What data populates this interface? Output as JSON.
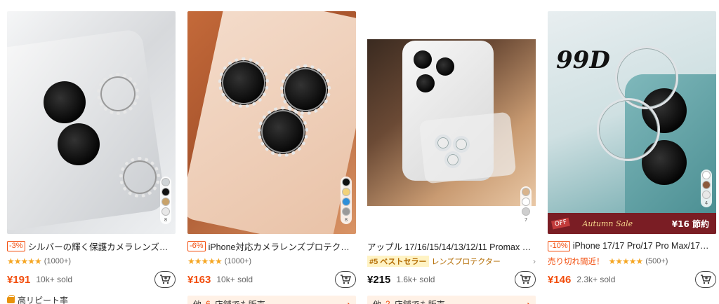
{
  "products": [
    {
      "discount": "-3%",
      "title": "シルバーの輝く保護カメラレンズ…",
      "rating_count": "(1000+)",
      "price": "¥191",
      "sold": "10k+ sold",
      "extra": "高リピート率",
      "swatch_count": "8",
      "swatches": [
        "#cfd3d6",
        "#111111",
        "#c8a26a",
        "#e8e8e8"
      ]
    },
    {
      "discount": "-6%",
      "title": "iPhone対応カメラレンズプロテク…",
      "rating_count": "(1000+)",
      "price": "¥163",
      "sold": "10k+ sold",
      "stores_prefix": "他",
      "stores_num": "6",
      "stores_suffix": "店舗でも販売",
      "swatch_count": "8",
      "swatches": [
        "#111111",
        "#f2d27a",
        "#2f8fd8",
        "#9a9a9a"
      ]
    },
    {
      "title": "アップル 17/16/15/14/13/12/11 Promax …",
      "best_badge": "#5 ベストセラー",
      "category": "レンズプロテクター",
      "price": "¥215",
      "sold": "1.6k+ sold",
      "stores_prefix": "他",
      "stores_num": "2",
      "stores_suffix": "店舗でも販売",
      "swatch_count": "7",
      "swatches": [
        "#d9b48c",
        "#ffffff",
        "#cfcfcf"
      ]
    },
    {
      "discount": "-10%",
      "title": "iPhone 17/17 Pro/17 Pro Max/17…",
      "almost_sold": "売り切れ間近！",
      "rating_count": "(500+)",
      "price": "¥146",
      "sold": "2.3k+ sold",
      "image_text": "99D",
      "promo_tag": "OFF",
      "promo_autumn": "Autumn Sale",
      "promo_savings": "¥16 節約",
      "swatch_count": "4",
      "swatches": [
        "#ffffff",
        "#8b5a3c",
        "#e8e8e8"
      ]
    }
  ]
}
